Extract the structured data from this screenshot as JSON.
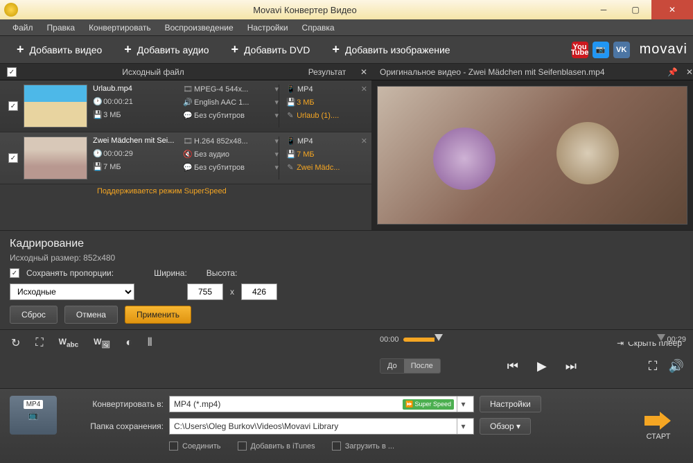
{
  "window": {
    "title": "Movavi Конвертер Видео"
  },
  "menu": {
    "file": "Файл",
    "edit": "Правка",
    "convert": "Конвертировать",
    "playback": "Воспроизведение",
    "settings": "Настройки",
    "help": "Справка"
  },
  "toolbar": {
    "add_video": "Добавить видео",
    "add_audio": "Добавить аудио",
    "add_dvd": "Добавить DVD",
    "add_image": "Добавить изображение",
    "brand": "movavi"
  },
  "headers": {
    "source": "Исходный файл",
    "result": "Результат",
    "preview": "Оригинальное видео - Zwei Mädchen mit Seifenblasen.mp4"
  },
  "files": [
    {
      "name": "Urlaub.mp4",
      "duration": "00:00:21",
      "size": "3 МБ",
      "codec": "MPEG-4 544x...",
      "audio": "English AAC 1...",
      "subs": "Без субтитров",
      "out_fmt": "MP4",
      "out_size": "3 МБ",
      "out_name": "Urlaub (1)...."
    },
    {
      "name": "Zwei Mädchen mit Sei...",
      "duration": "00:00:29",
      "size": "7 МБ",
      "codec": "H.264 852x48...",
      "audio": "Без аудио",
      "subs": "Без субтитров",
      "out_fmt": "MP4",
      "out_size": "7 МБ",
      "out_name": "Zwei Mädc...",
      "superspeed": "Поддерживается режим SuperSpeed"
    }
  ],
  "crop": {
    "title": "Кадрирование",
    "src_size": "Исходный размер: 852x480",
    "keep_ratio": "Сохранять пропорции:",
    "width_lbl": "Ширина:",
    "height_lbl": "Высота:",
    "width_val": "755",
    "height_val": "426",
    "preset": "Исходные",
    "reset": "Сброс",
    "cancel": "Отмена",
    "apply": "Применить"
  },
  "hide_player": "Скрыть плеер",
  "player": {
    "start": "00:00",
    "end": "00:29",
    "before": "До",
    "after": "После"
  },
  "bottom": {
    "convert_to_lbl": "Конвертировать в:",
    "convert_to_val": "MP4 (*.mp4)",
    "ss_badge": "Super Speed",
    "settings_btn": "Настройки",
    "save_folder_lbl": "Папка сохранения:",
    "save_folder_val": "C:\\Users\\Oleg Burkov\\Videos\\Movavi Library",
    "browse_btn": "Обзор",
    "opt_join": "Соединить",
    "opt_itunes": "Добавить в iTunes",
    "opt_upload": "Загрузить в ...",
    "start": "СТАРТ",
    "mp4": "MP4"
  }
}
